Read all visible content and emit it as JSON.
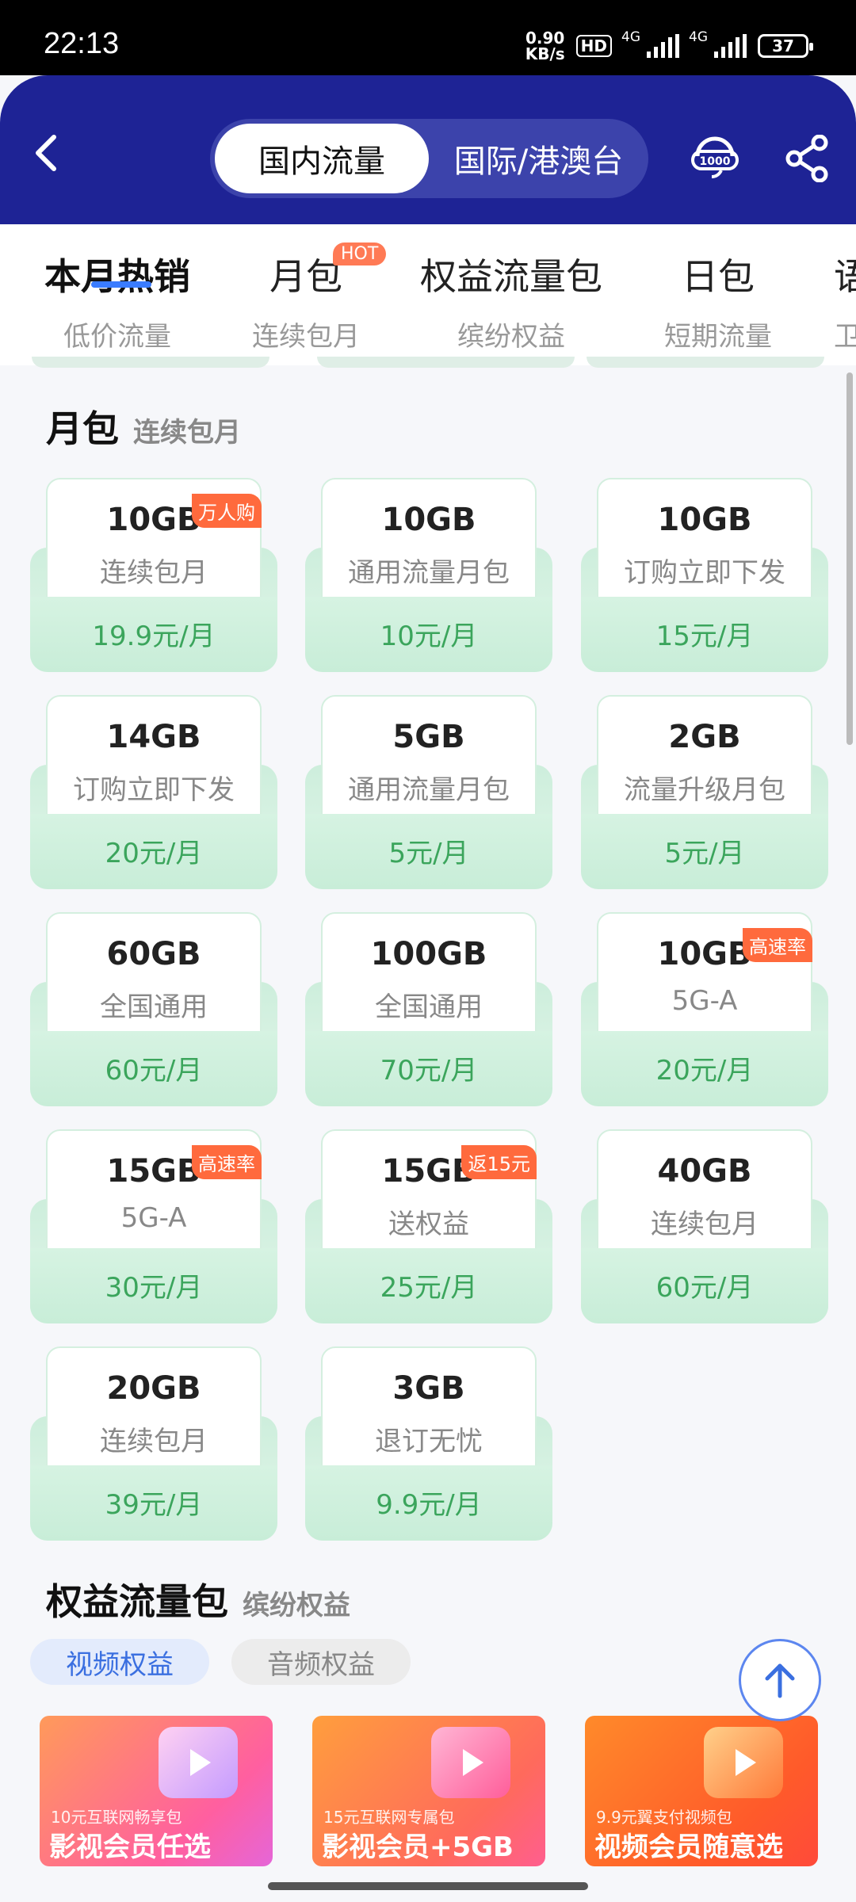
{
  "status": {
    "time": "22:13",
    "speed_top": "0.90",
    "speed_unit": "KB/s",
    "hd": "HD",
    "net1": "4G",
    "net2": "4G",
    "battery": "37"
  },
  "header": {
    "tabs": [
      {
        "label": "国内流量"
      },
      {
        "label": "国际/港澳台"
      }
    ],
    "icons": [
      "back-icon",
      "customer-service-10000-icon",
      "share-icon"
    ]
  },
  "categories": [
    {
      "title": "本月热销",
      "sub": "低价流量"
    },
    {
      "title": "月包",
      "sub": "连续包月",
      "badge": "HOT"
    },
    {
      "title": "权益流量包",
      "sub": "缤纷权益"
    },
    {
      "title": "日包",
      "sub": "短期流量"
    },
    {
      "title": "语",
      "sub": "卫"
    }
  ],
  "monthly": {
    "title": "月包",
    "subtitle": "连续包月",
    "cards": [
      {
        "gb": "10GB",
        "desc": "连续包月",
        "price": "19.9元/月",
        "badge": "万人购"
      },
      {
        "gb": "10GB",
        "desc": "通用流量月包",
        "price": "10元/月",
        "badge": ""
      },
      {
        "gb": "10GB",
        "desc": "订购立即下发",
        "price": "15元/月",
        "badge": ""
      },
      {
        "gb": "14GB",
        "desc": "订购立即下发",
        "price": "20元/月",
        "badge": ""
      },
      {
        "gb": "5GB",
        "desc": "通用流量月包",
        "price": "5元/月",
        "badge": ""
      },
      {
        "gb": "2GB",
        "desc": "流量升级月包",
        "price": "5元/月",
        "badge": ""
      },
      {
        "gb": "60GB",
        "desc": "全国通用",
        "price": "60元/月",
        "badge": ""
      },
      {
        "gb": "100GB",
        "desc": "全国通用",
        "price": "70元/月",
        "badge": ""
      },
      {
        "gb": "10GB",
        "desc": "5G-A",
        "price": "20元/月",
        "badge": "高速率"
      },
      {
        "gb": "15GB",
        "desc": "5G-A",
        "price": "30元/月",
        "badge": "高速率"
      },
      {
        "gb": "15GB",
        "desc": "送权益",
        "price": "25元/月",
        "badge": "返15元"
      },
      {
        "gb": "40GB",
        "desc": "连续包月",
        "price": "60元/月",
        "badge": ""
      },
      {
        "gb": "20GB",
        "desc": "连续包月",
        "price": "39元/月",
        "badge": ""
      },
      {
        "gb": "3GB",
        "desc": "退订无忧",
        "price": "9.9元/月",
        "badge": ""
      }
    ]
  },
  "rights": {
    "title": "权益流量包",
    "subtitle": "缤纷权益",
    "pills": [
      {
        "label": "视频权益"
      },
      {
        "label": "音频权益"
      }
    ],
    "promos": [
      {
        "line1": "10元互联网畅享包",
        "line2": "影视会员任选"
      },
      {
        "line1": "15元互联网专属包",
        "line2": "影视会员+5GB"
      },
      {
        "line1": "9.9元翼支付视频包",
        "line2": "视频会员随意选"
      }
    ]
  },
  "colors": {
    "header": "#1e2395",
    "accent": "#3a7cff",
    "price": "#3ba55c",
    "badge": "#ff6a3d"
  }
}
